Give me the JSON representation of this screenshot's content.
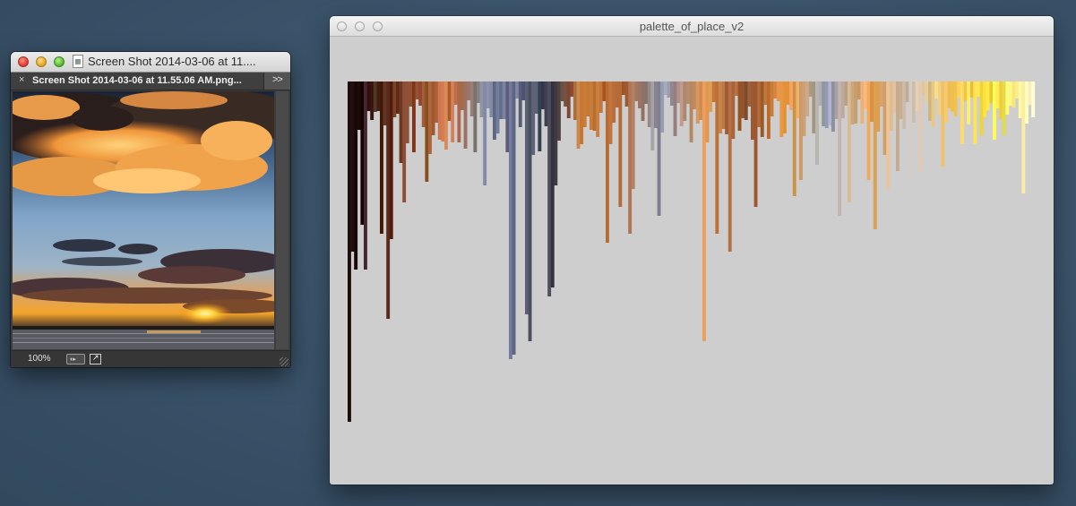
{
  "photoshop_window": {
    "title": "Screen Shot 2014-03-06 at 11....",
    "tab_label": "Screen Shot 2014-03-06 at 11.55.06 AM.png...",
    "tab_close": "×",
    "tab_overflow": ">>",
    "zoom": "100%",
    "status_button": "◐▸",
    "export_icon": "↗"
  },
  "sketch_window": {
    "title": "palette_of_place_v2"
  }
}
